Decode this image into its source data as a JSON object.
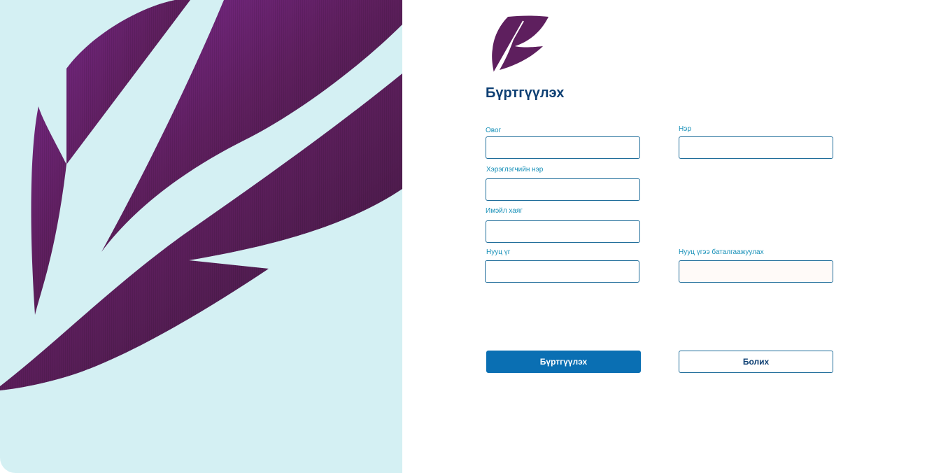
{
  "page": {
    "title": "Бүртгүүлэх"
  },
  "form": {
    "last_name": {
      "label": "Овог",
      "value": "",
      "placeholder": ""
    },
    "first_name": {
      "label": "Нэр",
      "value": "",
      "placeholder": ""
    },
    "username": {
      "label": "Хэрэглэгчийн нэр",
      "value": "",
      "placeholder": ""
    },
    "email": {
      "label": "Имэйл хаяг",
      "value": "",
      "placeholder": ""
    },
    "password": {
      "label": "Нууц үг",
      "value": "",
      "placeholder": ""
    },
    "password_confirm": {
      "label": "Нууц үгээ баталгаажуулах",
      "value": "",
      "placeholder": ""
    }
  },
  "actions": {
    "submit_label": "Бүртгүүлэх",
    "cancel_label": "Болих"
  },
  "colors": {
    "left_panel_bg": "#d4f0f3",
    "brand_purple": "#5e1f5e",
    "title_navy": "#0d3f73",
    "label_blue": "#1790b8",
    "primary_button": "#0a6fb3"
  },
  "icons": {
    "hero_art": "feather-graphic",
    "brand_logo": "feather-logo-icon"
  }
}
